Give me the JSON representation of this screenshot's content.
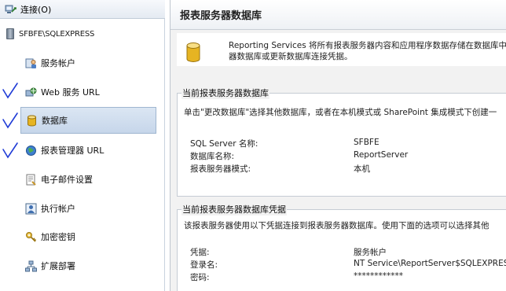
{
  "connect_bar": {
    "label": "连接(O)"
  },
  "server": {
    "name": "SFBFE\\SQLEXPRESS"
  },
  "nav": [
    {
      "id": "service-account",
      "label": "服务帐户",
      "icon": "service-account-icon",
      "checked": false,
      "selected": false
    },
    {
      "id": "web-service-url",
      "label": "Web 服务 URL",
      "icon": "web-service-icon",
      "checked": true,
      "selected": false
    },
    {
      "id": "database",
      "label": "数据库",
      "icon": "database-icon",
      "checked": true,
      "selected": true
    },
    {
      "id": "report-manager-url",
      "label": "报表管理器 URL",
      "icon": "globe-icon",
      "checked": true,
      "selected": false
    },
    {
      "id": "email-settings",
      "label": "电子邮件设置",
      "icon": "email-icon",
      "checked": false,
      "selected": false
    },
    {
      "id": "execution-account",
      "label": "执行帐户",
      "icon": "execution-account-icon",
      "checked": false,
      "selected": false
    },
    {
      "id": "encryption-keys",
      "label": "加密密钥",
      "icon": "key-icon",
      "checked": false,
      "selected": false
    },
    {
      "id": "scale-out",
      "label": "扩展部署",
      "icon": "scale-out-icon",
      "checked": false,
      "selected": false
    }
  ],
  "page": {
    "title": "报表服务器数据库",
    "intro_line1": "Reporting Services 将所有报表服务器内容和应用程序数据存储在数据库中。",
    "intro_line2": "器数据库或更新数据库连接凭据。"
  },
  "current_db": {
    "title": "当前报表服务器数据库",
    "desc": "单击\"更改数据库\"选择其他数据库，或者在本机模式或 SharePoint 集成模式下创建一",
    "rows": [
      {
        "key": "SQL Server 名称:",
        "value": "SFBFE"
      },
      {
        "key": "数据库名称:",
        "value": "ReportServer"
      },
      {
        "key": "报表服务器模式:",
        "value": "本机"
      }
    ]
  },
  "credentials": {
    "title": "当前报表服务器数据库凭据",
    "desc": "该报表服务器使用以下凭据连接到报表服务器数据库。使用下面的选项可以选择其他",
    "rows": [
      {
        "key": "凭据:",
        "value": "服务帐户"
      },
      {
        "key": "登录名:",
        "value": "NT Service\\ReportServer$SQLEXPRESS"
      },
      {
        "key": "密码:",
        "value": "************"
      }
    ]
  },
  "colors": {
    "accent": "#1f3bd6",
    "selected_bg": "#c6d6ea",
    "db_gold": "#e6b422"
  }
}
